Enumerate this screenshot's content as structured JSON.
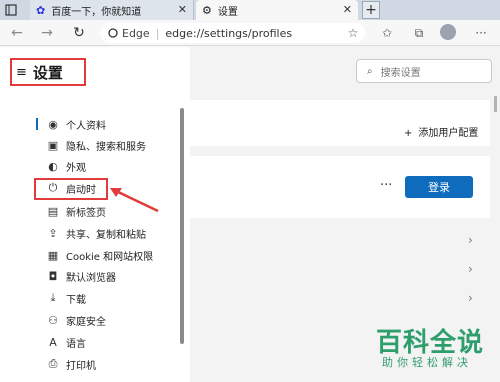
{
  "tabs": [
    {
      "label": "百度一下，你就知道"
    },
    {
      "label": "设置"
    }
  ],
  "toolbar": {
    "address_brand": "Edge",
    "address_url": "edge://settings/profiles"
  },
  "sidebar": {
    "title": "设置",
    "items": [
      {
        "label": "个人资料",
        "icon": "person-icon"
      },
      {
        "label": "隐私、搜索和服务",
        "icon": "lock-icon"
      },
      {
        "label": "外观",
        "icon": "appearance-icon"
      },
      {
        "label": "启动时",
        "icon": "power-icon"
      },
      {
        "label": "新标签页",
        "icon": "newtab-icon"
      },
      {
        "label": "共享、复制和粘贴",
        "icon": "share-icon"
      },
      {
        "label": "Cookie 和网站权限",
        "icon": "site-permissions-icon"
      },
      {
        "label": "默认浏览器",
        "icon": "browser-icon"
      },
      {
        "label": "下载",
        "icon": "download-icon"
      },
      {
        "label": "家庭安全",
        "icon": "family-icon"
      },
      {
        "label": "语言",
        "icon": "language-icon"
      },
      {
        "label": "打印机",
        "icon": "printer-icon"
      }
    ]
  },
  "main": {
    "search_placeholder": "搜索设置",
    "add_profile": "添加用户配置",
    "login_button": "登录",
    "more": "···"
  },
  "watermark": {
    "line1": "百科全说",
    "line2": "助你轻松解决"
  },
  "colors": {
    "accent": "#0f6cbd",
    "annotation_red": "#e23b3b"
  }
}
